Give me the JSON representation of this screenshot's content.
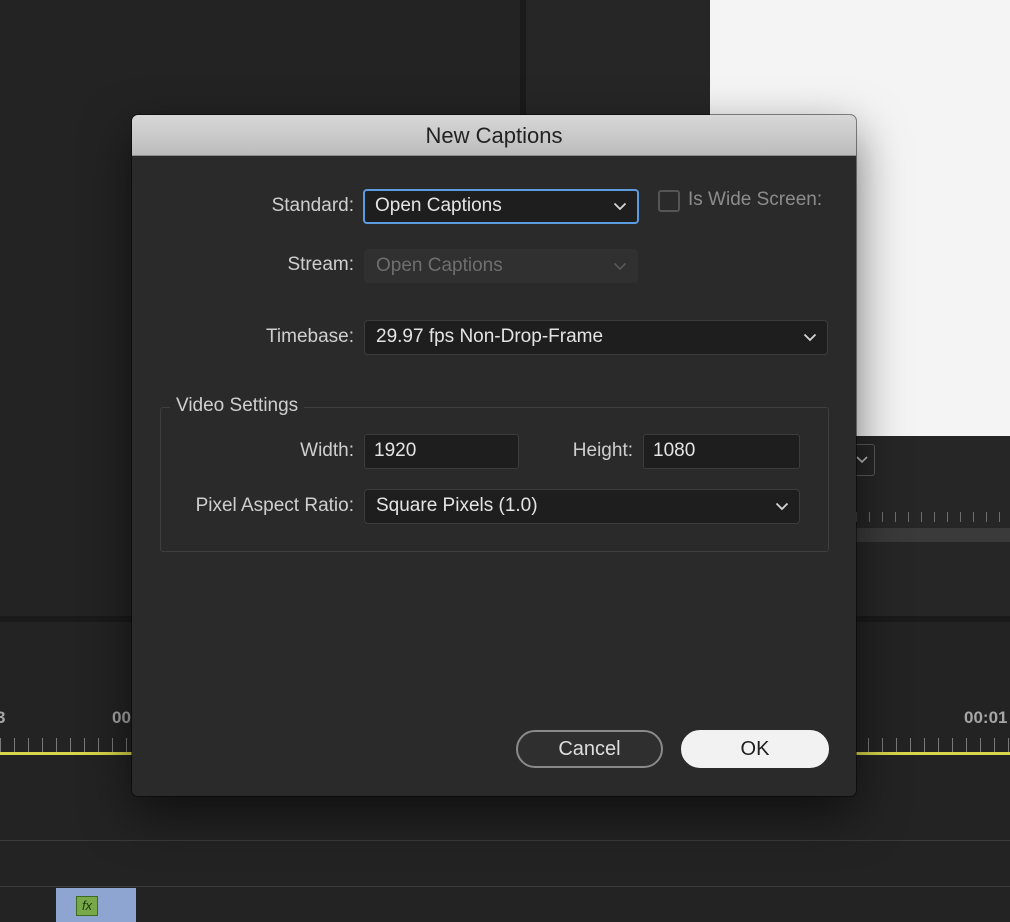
{
  "background": {
    "timecode_left_partial": "3",
    "timecode_mid_partial": "00",
    "timecode_right_partial": "00:01",
    "fx_badge": "fx"
  },
  "dialog": {
    "title": "New Captions",
    "standard": {
      "label": "Standard:",
      "value": "Open Captions"
    },
    "wide_screen": {
      "label": "Is Wide Screen:",
      "checked": false
    },
    "stream": {
      "label": "Stream:",
      "value": "Open Captions",
      "disabled": true
    },
    "timebase": {
      "label": "Timebase:",
      "value": "29.97 fps Non-Drop-Frame"
    },
    "video_settings": {
      "title": "Video Settings",
      "width": {
        "label": "Width:",
        "value": "1920"
      },
      "height": {
        "label": "Height:",
        "value": "1080"
      },
      "pixel_aspect_ratio": {
        "label": "Pixel Aspect Ratio:",
        "value": "Square Pixels (1.0)"
      }
    },
    "buttons": {
      "cancel": "Cancel",
      "ok": "OK"
    }
  },
  "colors": {
    "focus_ring": "#5c9be0",
    "playhead": "#d8d64a",
    "clip": "#8da5d0",
    "fx_badge": "#78a848"
  }
}
